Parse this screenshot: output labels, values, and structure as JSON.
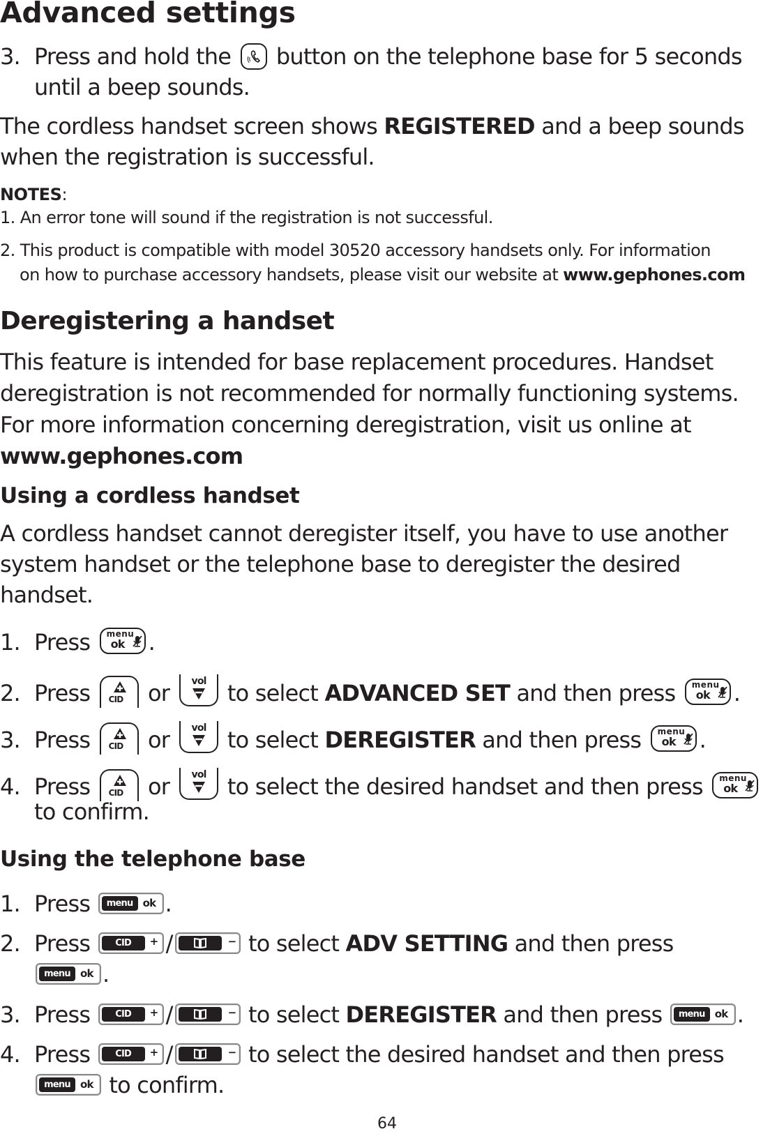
{
  "page": {
    "title": "Advanced settings",
    "page_number": "64"
  },
  "registration": {
    "step3": {
      "num": "3.",
      "pre": "Press and hold the",
      "icon": "phone-locator-icon",
      "post": "button on the telephone base for 5 seconds",
      "line2": "until a beep sounds."
    },
    "result": {
      "pre": "The cordless handset screen shows",
      "bold": "REGISTERED",
      "post": "and a beep sounds",
      "line2": "when the registration is successful."
    },
    "notes_label": "NOTES",
    "notes_colon": ":",
    "notes": [
      {
        "text": "1. An error tone will sound if the registration is not successful."
      },
      {
        "line1": "2. This product is compatible with model 30520 accessory handsets only. For information",
        "line2_pre": "on how to purchase accessory handsets, please visit our website at",
        "line2_link": "www.gephones.com"
      }
    ]
  },
  "deregister": {
    "heading": "Deregistering a handset",
    "intro_lines": [
      "This feature is intended for base replacement procedures. Handset",
      "deregistration is not recommended for normally functioning systems.",
      "For more information concerning deregistration, visit us online at"
    ],
    "link": "www.gephones.com"
  },
  "cordless": {
    "heading": "Using a cordless handset",
    "intro_lines": [
      "A cordless handset cannot deregister itself, you have to use another",
      "system handset or the telephone base to deregister the desired",
      "handset."
    ],
    "steps": [
      {
        "num": "1.",
        "press": "Press",
        "end": "."
      },
      {
        "num": "2.",
        "press": "Press",
        "or": "or",
        "pre": "to select",
        "bold": "ADVANCED SET",
        "post": "and then press",
        "end": "."
      },
      {
        "num": "3.",
        "press": "Press",
        "or": "or",
        "pre": "to select",
        "bold": "DEREGISTER",
        "post": "and then press",
        "end": "."
      },
      {
        "num": "4.",
        "press": "Press",
        "or": "or",
        "pre": "to select the desired handset and then press",
        "line2": "to confirm."
      }
    ]
  },
  "base": {
    "heading": "Using the telephone base",
    "steps": [
      {
        "num": "1.",
        "press": "Press",
        "end": "."
      },
      {
        "num": "2.",
        "press": "Press",
        "slash": "/",
        "pre": "to select",
        "bold": "ADV SETTING",
        "post": "and then press",
        "end": "."
      },
      {
        "num": "3.",
        "press": "Press",
        "slash": "/",
        "pre": "to select",
        "bold": "DEREGISTER",
        "post": "and then press",
        "end": "."
      },
      {
        "num": "4.",
        "press": "Press",
        "slash": "/",
        "pre": "to select the desired handset and then press",
        "line2": "to confirm."
      }
    ]
  },
  "keys": {
    "handset_menu_top": "menu",
    "handset_menu_bottom": "ok",
    "handset_cid": "CID",
    "handset_vol": "vol",
    "base_menu": "menu",
    "base_ok": "ok",
    "base_cid": "CID",
    "base_plus": "+",
    "base_minus": "−"
  }
}
